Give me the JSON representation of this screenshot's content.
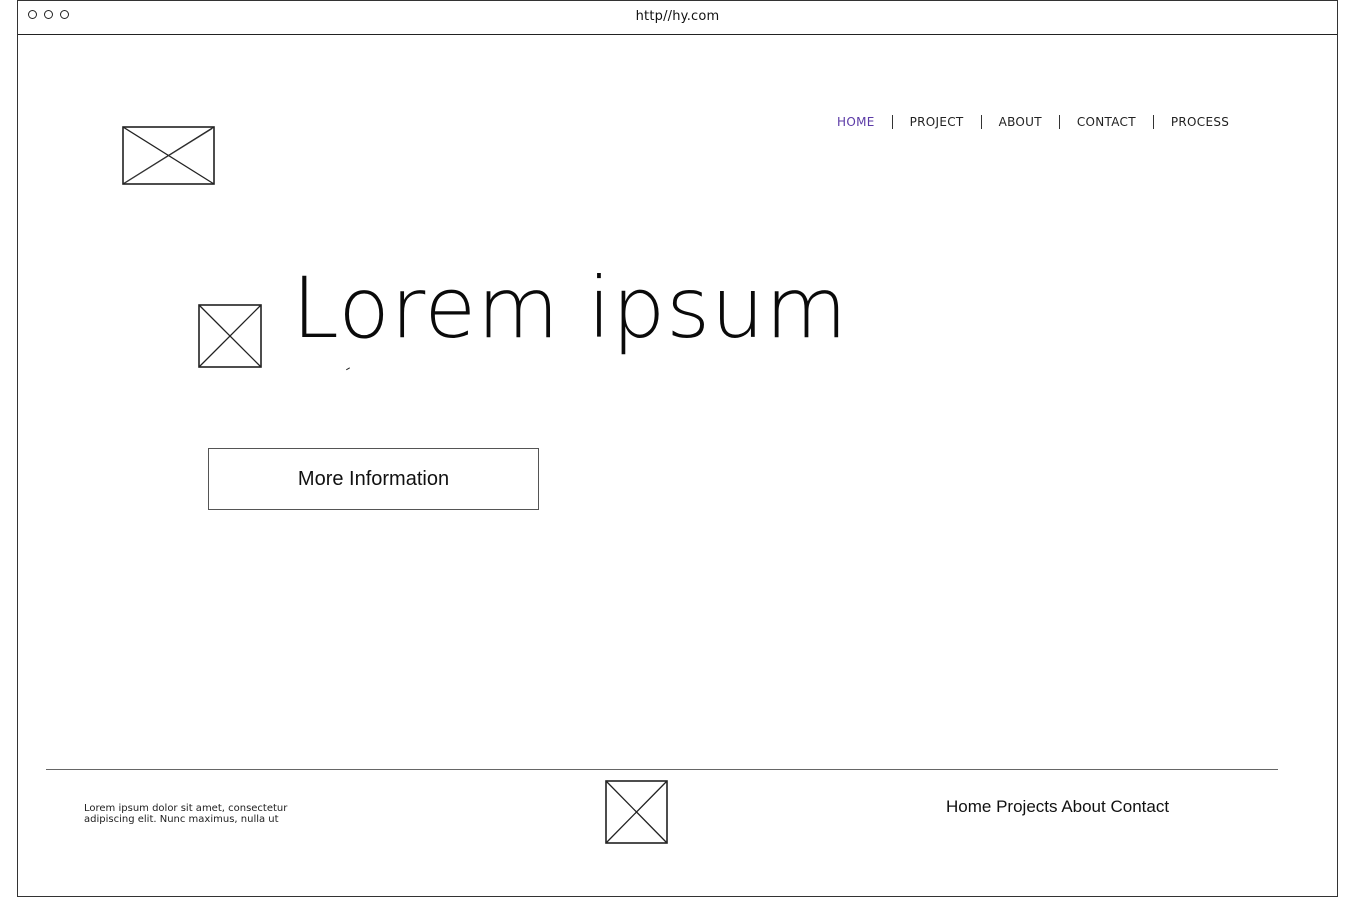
{
  "browser": {
    "url": "http//hy.com"
  },
  "header": {
    "logo_icon": "image-placeholder-icon",
    "nav": [
      {
        "label": "HOME",
        "active": true
      },
      {
        "label": "PROJECT",
        "active": false
      },
      {
        "label": "ABOUT",
        "active": false
      },
      {
        "label": "CONTACT",
        "active": false
      },
      {
        "label": "PROCESS",
        "active": false
      }
    ],
    "active_color": "#5b3aa6"
  },
  "hero": {
    "icon": "image-placeholder-icon",
    "title": "Lorem ipsum",
    "button_label": "More Information"
  },
  "footer": {
    "text": "Lorem ipsum dolor sit amet, consectetur adipiscing elit. Nunc maximus, nulla ut",
    "icon": "image-placeholder-icon",
    "links": [
      "Home",
      "Projects",
      "About",
      "Contact"
    ]
  }
}
